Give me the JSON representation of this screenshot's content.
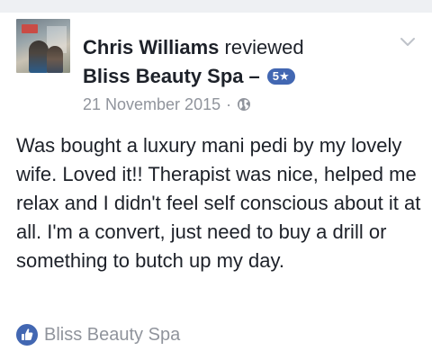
{
  "review": {
    "author": "Chris Williams",
    "action": "reviewed",
    "business": "Bliss Beauty Spa",
    "separator": "–",
    "rating_badge": "5★",
    "date": "21 November 2015",
    "meta_separator": "·",
    "privacy_icon": "globe-icon",
    "menu_icon": "chevron-down-icon",
    "text": "Was bought a luxury mani pedi by my lovely wife. Loved it!! Therapist was nice, helped me relax and I didn't feel self conscious about it at all. I'm a convert, just need to buy a drill or something to butch up my day."
  },
  "footer": {
    "page_icon": "like-icon",
    "page_name": "Bliss Beauty Spa"
  },
  "colors": {
    "text": "#1d2129",
    "meta": "#90949c",
    "accent": "#4267b2",
    "background": "#ffffff"
  }
}
